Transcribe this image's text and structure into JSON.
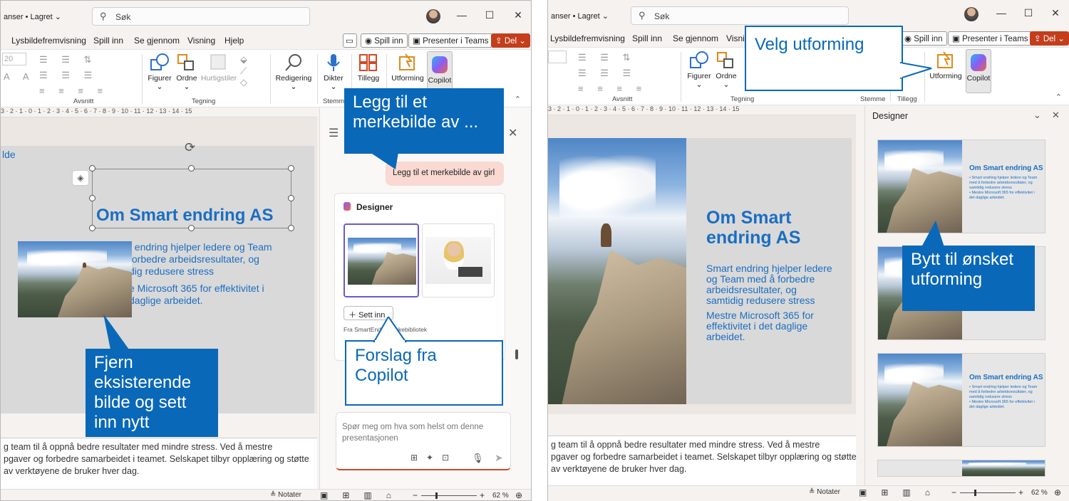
{
  "left": {
    "titlebar": {
      "title": "anser • Lagret ⌄",
      "search_placeholder": "Søk"
    },
    "menu": [
      "Lysbildefremvisning",
      "Spill inn",
      "Se gjennom",
      "Visning",
      "Hjelp"
    ],
    "buttons": {
      "record": "Spill inn",
      "present": "Presenter i Teams",
      "share": "Del"
    },
    "ribbon": {
      "font_size": "20",
      "groups": [
        {
          "label": "Avsnitt"
        },
        {
          "label": "Tegning"
        },
        {
          "label": "Stemme"
        }
      ],
      "tools": [
        "Figurer",
        "Ordne",
        "Hurtigstiler",
        "Redigering",
        "Dikter",
        "Tillegg",
        "Utforming",
        "Copilot"
      ]
    },
    "ruler": "3 · 2 · 1 · 0 · 1 · 2 · 3 · 4 · 5 · 6 · 7 · 8 · 9 · 10 · 11 · 12 · 13 · 14 · 15",
    "slide": {
      "link_text": "lde",
      "title": "Om Smart endring AS",
      "body1": "t endring hjelper ledere og Team\nforbedre arbeidsresultater, og\ndig redusere stress",
      "body2": "e Microsoft 365 for effektivitet i\ndaglige arbeidet."
    },
    "notes": "g team til å oppnå bedre resultater med mindre stress. Ved å mestre\npgaver og forbedre samarbeidet i teamet. Selskapet tilbyr opplæring og støtte\nav verktøyene de bruker hver dag.",
    "copilot": {
      "user_prompt": "Legg til et merkebilde av girl",
      "designer_label": "Designer",
      "insert_button": "Sett inn",
      "from_library": "Fra SmartEnd... merkebibliotek",
      "input_placeholder": "Spør meg om hva som helst om denne presentasjonen"
    },
    "status": {
      "notes": "Notater",
      "zoom": "62 %"
    },
    "callouts": {
      "top": "Legg til et merkebilde av ...",
      "bottom_left": "Fjern eksisterende bilde og sett inn nytt",
      "bottom_right": "Forslag fra Copilot"
    }
  },
  "right": {
    "titlebar": {
      "title": "anser • Lagret ⌄",
      "search_placeholder": "Søk"
    },
    "menu": [
      "Lysbildefremvisning",
      "Spill inn",
      "Se gjennom",
      "Visni"
    ],
    "buttons": {
      "record": "Spill inn",
      "present": "Presenter i Teams",
      "share": "Del"
    },
    "ribbon": {
      "groups": [
        {
          "label": "Avsnitt"
        },
        {
          "label": "Tegning"
        },
        {
          "label": "Stemme"
        },
        {
          "label": "Tillegg"
        }
      ],
      "tools": [
        "Figurer",
        "Ordne",
        "Utforming",
        "Copilot"
      ]
    },
    "ruler": "3 · 2 · 1 · 0 · 1 · 2 · 3 · 4 · 5 · 6 · 7 · 8 · 9 · 10 · 11 · 12 · 13 · 14 · 15",
    "slide": {
      "title": "Om Smart\nendring AS",
      "body1": "Smart endring hjelper ledere\nog Team med å forbedre\narbeidsresultater, og\nsamtidig redusere stress",
      "body2": "Mestre Microsoft 365 for\neffektivitet i det daglige\narbeidet."
    },
    "notes": "g team til å oppnå bedre resultater med mindre stress. Ved å mestre\npgaver og forbedre samarbeidet i teamet. Selskapet tilbyr opplæring og støtte\nav verktøyene de bruker hver dag.",
    "designer": {
      "title": "Designer",
      "thumb_title": "Om Smart endring AS",
      "thumb_body": "• Smart endring hjelper ledere og Team med å forbedre arbeidsresultater, og samtidig redusere stress\n• Mestre Microsoft 365 for effektivitet i det daglige arbeidet."
    },
    "status": {
      "notes": "Notater",
      "zoom": "62 %"
    },
    "callouts": {
      "top": "Velg utforming",
      "middle": "Bytt til ønsket utforming"
    }
  }
}
